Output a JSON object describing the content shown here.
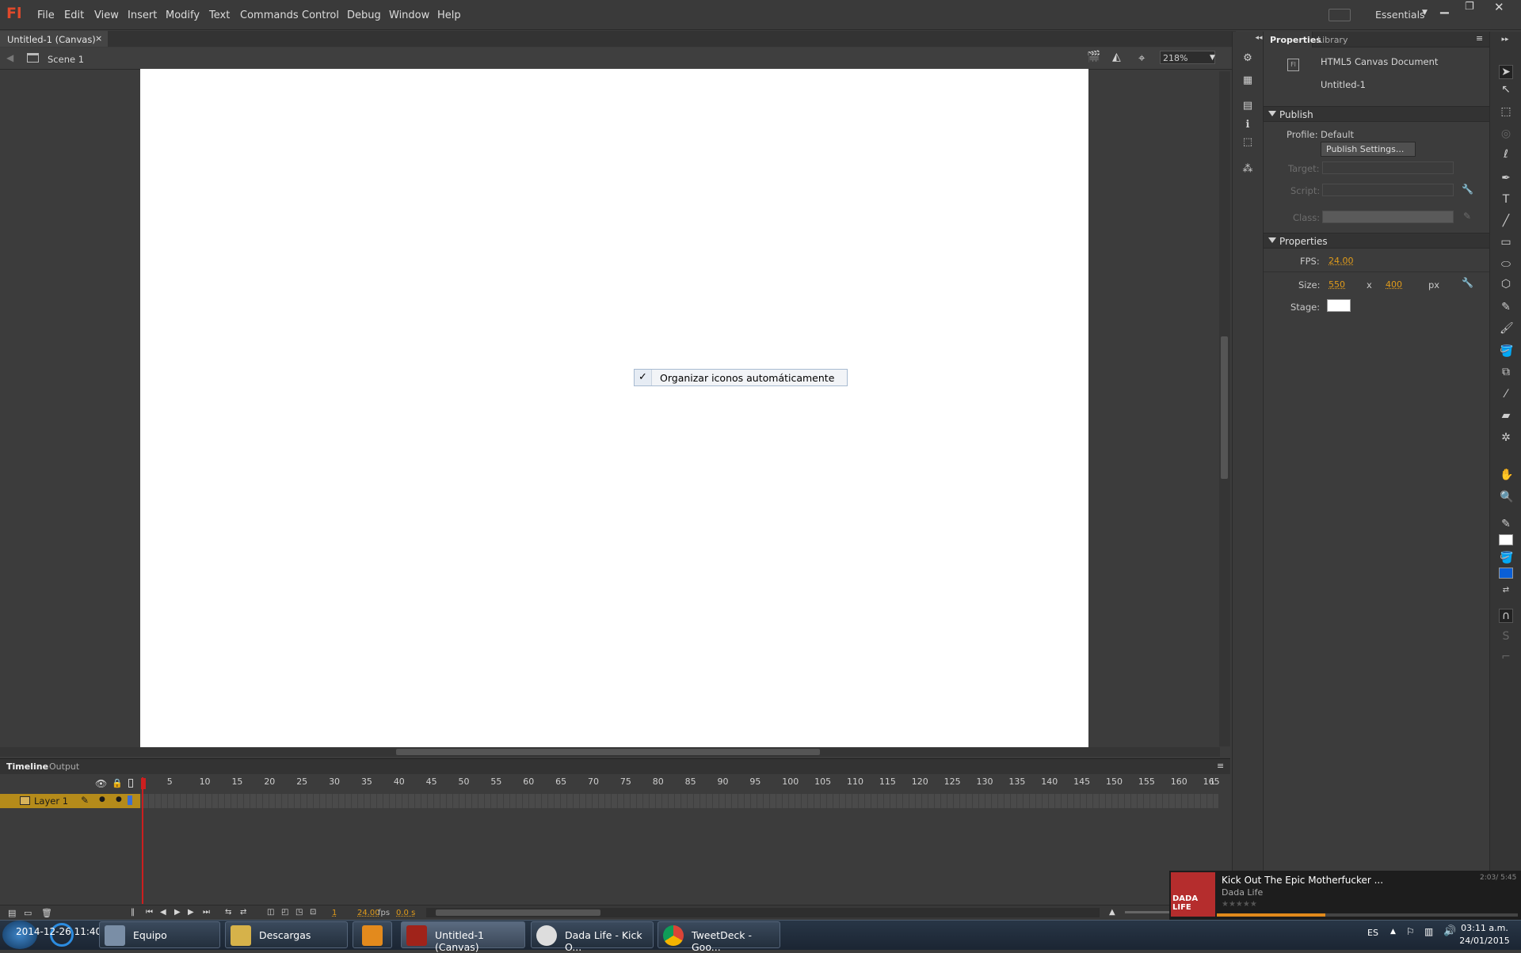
{
  "app": {
    "logo": "Fl",
    "workspace": "Essentials"
  },
  "menu": [
    "File",
    "Edit",
    "View",
    "Insert",
    "Modify",
    "Text",
    "Commands",
    "Control",
    "Debug",
    "Window",
    "Help"
  ],
  "document_tab": {
    "title": "Untitled-1 (Canvas)",
    "close": "×"
  },
  "editbar": {
    "scene": "Scene 1",
    "zoom": "218%"
  },
  "context_menu": {
    "item": "Organizar iconos automáticamente",
    "check": "✓"
  },
  "timeline": {
    "tabs": [
      "Timeline",
      "Output"
    ],
    "layer_name": "Layer 1",
    "ruler": [
      "1",
      "5",
      "10",
      "15",
      "20",
      "25",
      "30",
      "35",
      "40",
      "45",
      "50",
      "55",
      "60",
      "65",
      "70",
      "75",
      "80",
      "85",
      "90",
      "95",
      "100",
      "105",
      "110",
      "115",
      "120",
      "125",
      "130",
      "135",
      "140",
      "145",
      "150",
      "155",
      "160",
      "165",
      "1"
    ],
    "current_frame": "1",
    "fps_display": "24.00",
    "fps_unit": "fps",
    "time_display": "0.0 s"
  },
  "panel": {
    "tabs": [
      "Properties",
      "Library"
    ],
    "doc_type": "HTML5 Canvas Document",
    "doc_name": "Untitled-1",
    "publish": {
      "header": "Publish",
      "profile_label": "Profile:",
      "profile_value": "Default",
      "publish_settings_button": "Publish Settings...",
      "target_label": "Target:",
      "script_label": "Script:",
      "class_label": "Class:"
    },
    "properties": {
      "header": "Properties",
      "fps_label": "FPS:",
      "fps_value": "24.00",
      "size_label": "Size:",
      "width": "550",
      "x": "x",
      "height": "400",
      "unit": "px",
      "stage_label": "Stage:",
      "stage_color": "#ffffff"
    }
  },
  "media_player": {
    "track": "Kick Out The Epic Motherfucker ...",
    "artist": "Dada Life",
    "time": "2:03/ 5:45",
    "album_art": "DADA LIFE",
    "progress": 0.36
  },
  "taskbar": {
    "buttons": [
      "Equipo",
      "Descargas",
      "",
      "Untitled-1 (Canvas)",
      "Dada Life - Kick O...",
      "TweetDeck - Goo..."
    ],
    "lang": "ES",
    "time": "03:11 a.m.",
    "date": "24/01/2015",
    "overlay": "2014-12-26 11:40 Equipo"
  },
  "colors": {
    "flash_red": "#e0492b",
    "accent_orange": "#e09b1a",
    "layer_highlight": "#b58b1a",
    "fill_blue": "#0a5fd6"
  }
}
